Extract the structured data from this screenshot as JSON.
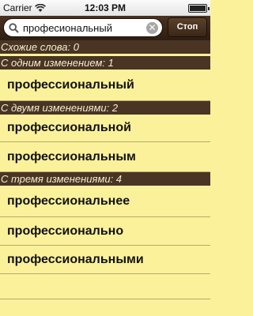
{
  "status_bar": {
    "carrier": "Carrier",
    "time": "12:03 PM"
  },
  "search": {
    "query": "професиональный",
    "stop_label": "Стоп"
  },
  "sections": {
    "similar": {
      "header": "Схожие слова: 0"
    },
    "one_change": {
      "header": "С одним изменением: 1",
      "items": [
        "профессиональный"
      ]
    },
    "two_changes": {
      "header": "С двумя изменениями: 2",
      "items": [
        "профессиональной",
        "профессиональным"
      ]
    },
    "three_changes": {
      "header": "С тремя изменениями: 4",
      "items": [
        "профессиональнее",
        "профессионально",
        "профессиональными"
      ]
    }
  },
  "colors": {
    "background": "#fbf19a",
    "header_bg": "#4a3424",
    "header_text": "#f4edd0"
  },
  "icons": [
    "wifi-icon",
    "battery-icon",
    "search-icon",
    "clear-icon"
  ]
}
